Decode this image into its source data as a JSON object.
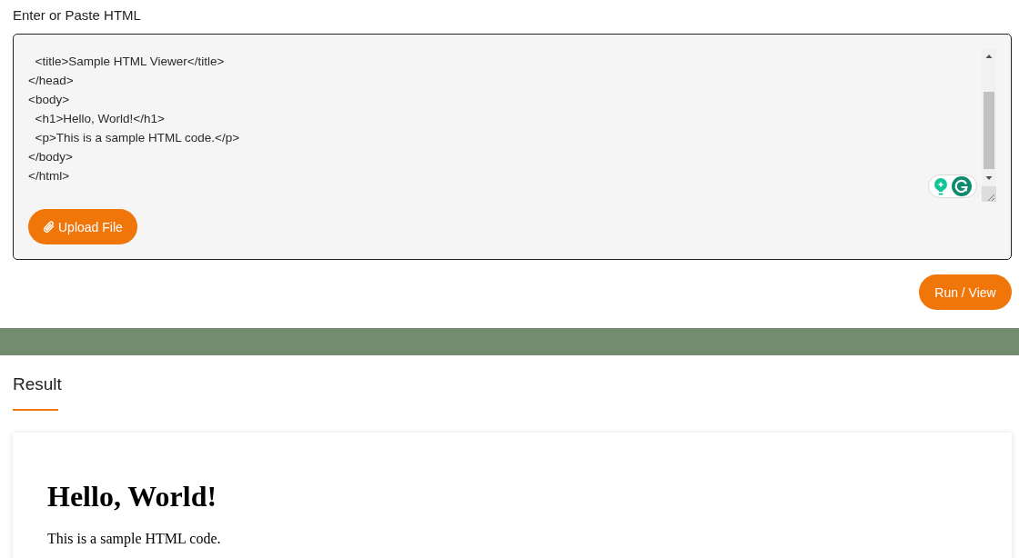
{
  "editor": {
    "label": "Enter or Paste HTML",
    "code_lines": [
      "  <title>Sample HTML Viewer</title>",
      "</head>",
      "<body>",
      "  <h1>Hello, World!</h1>",
      "  <p>This is a sample HTML code.</p>",
      "</body>",
      "</html>"
    ],
    "upload_button": "Upload File"
  },
  "run_button": "Run / View",
  "result": {
    "title": "Result",
    "heading": "Hello, World!",
    "paragraph": "This is a sample HTML code."
  }
}
